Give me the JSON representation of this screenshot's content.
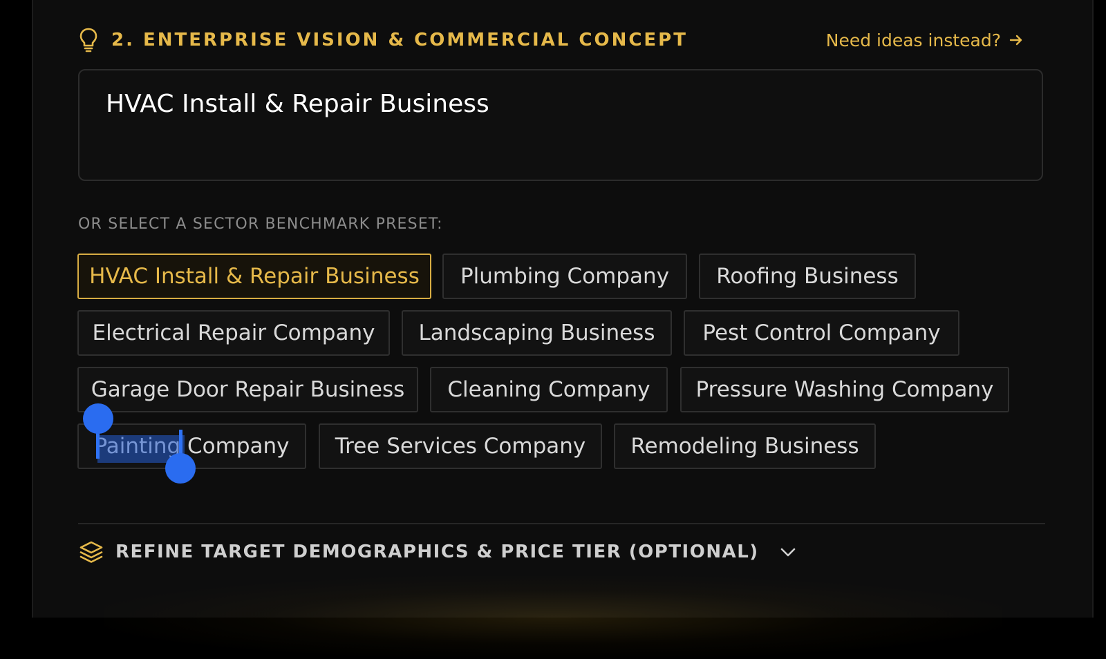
{
  "section": {
    "title": "2. ENTERPRISE VISION & COMMERCIAL CONCEPT",
    "title_icon": "lightbulb-icon",
    "ideas_link": "Need ideas instead?",
    "ideas_icon": "arrow-right-icon"
  },
  "concept": {
    "value": "HVAC Install & Repair Business"
  },
  "presets": {
    "label": "OR SELECT A SECTOR BENCHMARK PRESET:",
    "selected": "HVAC Install & Repair Business",
    "items": [
      "HVAC Install & Repair Business",
      "Plumbing Company",
      "Roofing Business",
      "Electrical Repair Company",
      "Landscaping Business",
      "Pest Control Company",
      "Garage Door Repair Business",
      "Cleaning Company",
      "Pressure Washing Company",
      "Painting Company",
      "Tree Services Company",
      "Remodeling Business"
    ]
  },
  "text_selection": {
    "selected_text": "Painting"
  },
  "refine": {
    "label": "REFINE TARGET DEMOGRAPHICS & PRICE TIER (OPTIONAL)",
    "icon": "layers-icon",
    "toggle_icon": "chevron-down-icon"
  },
  "colors": {
    "accent": "#e6b94a",
    "background": "#0d0d0d",
    "selection": "#2a6cf0"
  }
}
